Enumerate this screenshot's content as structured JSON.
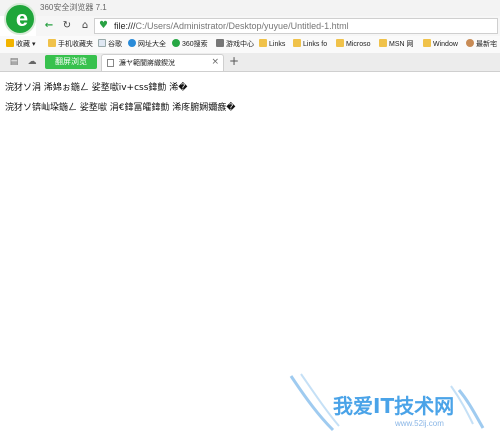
{
  "window": {
    "title": "360安全浏览器 7.1"
  },
  "nav": {
    "url_scheme": "file:///",
    "url_path": "C:/Users/Administrator/Desktop/yuyue/Untitled-1.html"
  },
  "bookmarks": [
    {
      "label": "收藏",
      "icon": "star-icon",
      "color": "#f2b400"
    },
    {
      "label": "手机收藏夹",
      "icon": "folder-icon",
      "color": "#f0c24a"
    },
    {
      "label": "谷歌",
      "icon": "page-icon",
      "color": "#dfe7f2"
    },
    {
      "label": "网址大全",
      "icon": "globe-icon",
      "color": "#2a8bd8"
    },
    {
      "label": "360搜索",
      "icon": "search-icon",
      "color": "#27a744"
    },
    {
      "label": "游戏中心",
      "icon": "gamepad-icon",
      "color": "#777777"
    },
    {
      "label": "Links",
      "icon": "folder-icon",
      "color": "#f0c24a"
    },
    {
      "label": "Links fo",
      "icon": "folder-icon",
      "color": "#f0c24a"
    },
    {
      "label": "Microso",
      "icon": "folder-icon",
      "color": "#f0c24a"
    },
    {
      "label": "MSN 网",
      "icon": "folder-icon",
      "color": "#f0c24a"
    },
    {
      "label": "Window",
      "icon": "folder-icon",
      "color": "#f0c24a"
    },
    {
      "label": "最新宅",
      "icon": "avatar-icon",
      "color": "#c88b55"
    }
  ],
  "tabs": {
    "special_tab_label": "翻屏浏览",
    "active_tab_title": "濂ヤ範閬嶈繖鍥涗",
    "close_glyph": "×",
    "new_tab_glyph": "+"
  },
  "content": {
    "line1": "浣犲ソ涓   浠婂ぉ鍦ㄥ   娑堥噷iv+css鍏勯   浠�",
    "line2": "浣犲ソ锛屾垜鍦ㄥ   娑堥噷   涓€鍏冨皬鍏勯   浠庝腑娴嬭瘯�"
  },
  "watermark": {
    "text": "我爱IT技术网",
    "url": "www.52ij.com"
  },
  "colors": {
    "brand_green": "#1fa63a",
    "special_tab": "#37c14d",
    "watermark_blue": "#4aa3e8"
  }
}
